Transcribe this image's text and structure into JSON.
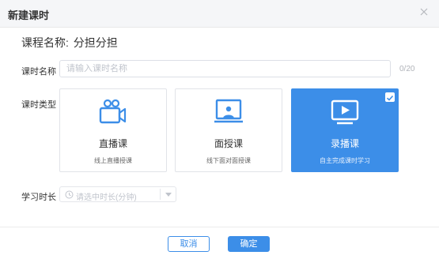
{
  "dialog": {
    "title": "新建课时"
  },
  "course": {
    "label": "课程名称:",
    "value": "分担分担"
  },
  "lesson_name": {
    "label": "课时名称",
    "placeholder": "请输入课时名称",
    "counter": "0/20"
  },
  "lesson_type": {
    "label": "课时类型",
    "options": [
      {
        "name": "直播课",
        "desc": "线上直播授课",
        "icon": "camera-icon",
        "selected": false
      },
      {
        "name": "面授课",
        "desc": "线下面对面授课",
        "icon": "lecture-screen-icon",
        "selected": false
      },
      {
        "name": "录播课",
        "desc": "自主完成课时学习",
        "icon": "video-player-icon",
        "selected": true
      }
    ]
  },
  "duration": {
    "label": "学习时长",
    "placeholder": "请选中时长(分钟)"
  },
  "footer": {
    "cancel_label": "取消",
    "confirm_label": "确定"
  },
  "colors": {
    "accent": "#3c8ee8",
    "header_bg": "#f5f6f8",
    "border": "#e1e3e8"
  }
}
